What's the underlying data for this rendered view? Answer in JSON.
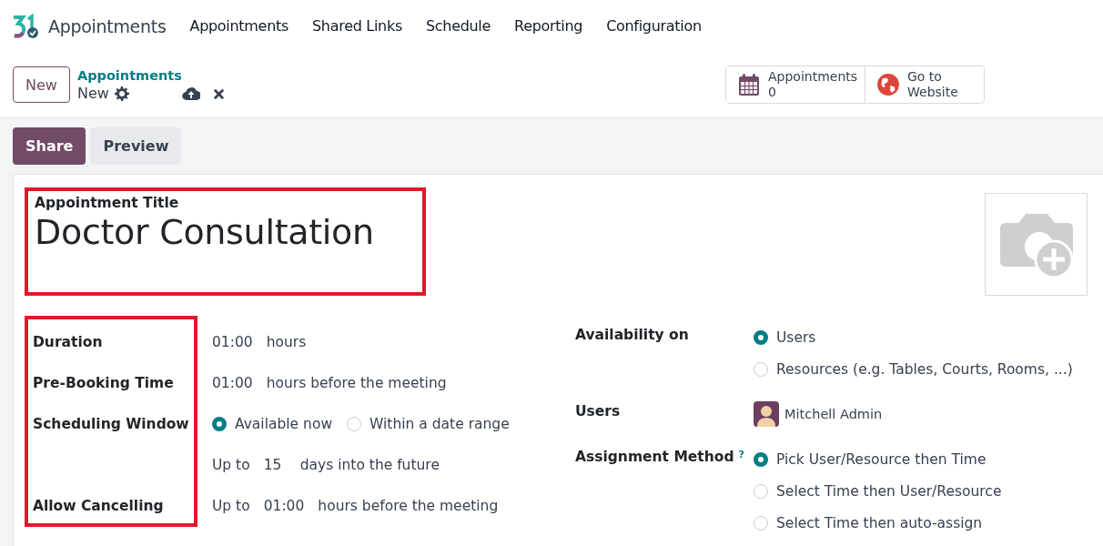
{
  "navbar": {
    "app_name": "Appointments",
    "menu": [
      "Appointments",
      "Shared Links",
      "Schedule",
      "Reporting",
      "Configuration"
    ]
  },
  "control_panel": {
    "new_button": "New",
    "breadcrumb": "Appointments",
    "record": "New",
    "smart_buttons": [
      {
        "kind": "calendar",
        "label": "Appointments",
        "value": "0"
      },
      {
        "kind": "globe",
        "label": "Go to Website"
      }
    ]
  },
  "status_buttons": [
    {
      "label": "Share",
      "primary": true
    },
    {
      "label": "Preview",
      "primary": false
    }
  ],
  "form": {
    "title_label": "Appointment Title",
    "title": "Doctor Consultation",
    "title_highlighted": true,
    "labels_highlighted": true,
    "left_fields": [
      {
        "label": "Duration",
        "parts": [
          {
            "kind": "value",
            "text": "01:00"
          },
          {
            "kind": "text",
            "text": "hours"
          }
        ]
      },
      {
        "label": "Pre-Booking Time",
        "parts": [
          {
            "kind": "value",
            "text": "01:00"
          },
          {
            "kind": "text",
            "text": "hours before the meeting"
          }
        ]
      },
      {
        "label": "Scheduling Window",
        "parts": [
          {
            "kind": "radio",
            "text": "Available now",
            "selected": true
          },
          {
            "kind": "radio",
            "text": "Within a date range",
            "selected": false
          }
        ]
      },
      {
        "parts": [
          {
            "kind": "text",
            "text": "Up to"
          },
          {
            "kind": "value",
            "text": "15"
          },
          {
            "kind": "text",
            "text": "days into the future"
          }
        ]
      },
      {
        "label": "Allow Cancelling",
        "parts": [
          {
            "kind": "text",
            "text": "Up to"
          },
          {
            "kind": "value",
            "text": "01:00"
          },
          {
            "kind": "text",
            "text": "hours before the meeting"
          }
        ]
      }
    ],
    "right_fields": [
      {
        "label": "Availability on",
        "kind": "radios",
        "options": [
          {
            "text": "Users",
            "selected": true
          },
          {
            "text": "Resources (e.g. Tables, Courts, Rooms, ...)",
            "selected": false
          }
        ]
      },
      {
        "label": "Users",
        "kind": "users",
        "users": [
          "Mitchell Admin"
        ]
      },
      {
        "label": "Assignment Method",
        "help": "?",
        "kind": "radios",
        "options": [
          {
            "text": "Pick User/Resource then Time",
            "selected": true
          },
          {
            "text": "Select Time then User/Resource",
            "selected": false
          },
          {
            "text": "Select Time then auto-assign",
            "selected": false
          }
        ]
      }
    ]
  }
}
